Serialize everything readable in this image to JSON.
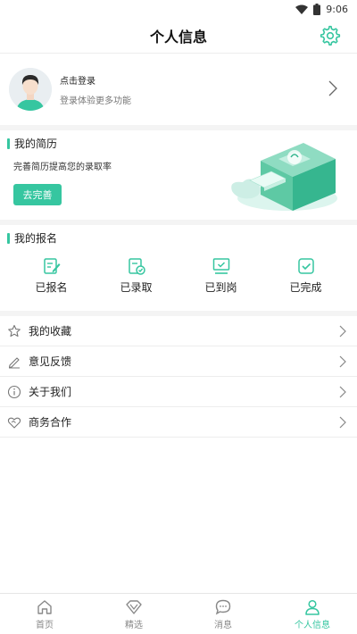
{
  "status_bar": {
    "time": "9:06"
  },
  "header": {
    "title": "个人信息"
  },
  "profile": {
    "title": "点击登录",
    "subtitle": "登录体验更多功能"
  },
  "resume": {
    "title": "我的简历",
    "description": "完善简历提高您的录取率",
    "button": "去完善"
  },
  "signup": {
    "title": "我的报名",
    "items": [
      {
        "label": "已报名",
        "icon": "edit-doc-icon"
      },
      {
        "label": "已录取",
        "icon": "approved-doc-icon"
      },
      {
        "label": "已到岗",
        "icon": "monitor-check-icon"
      },
      {
        "label": "已完成",
        "icon": "check-square-icon"
      }
    ]
  },
  "menu": [
    {
      "label": "我的收藏",
      "icon": "star-icon"
    },
    {
      "label": "意见反馈",
      "icon": "pencil-icon"
    },
    {
      "label": "关于我们",
      "icon": "info-icon"
    },
    {
      "label": "商务合作",
      "icon": "handshake-icon"
    }
  ],
  "tabs": [
    {
      "label": "首页",
      "icon": "home-icon"
    },
    {
      "label": "精选",
      "icon": "diamond-icon"
    },
    {
      "label": "消息",
      "icon": "chat-icon"
    },
    {
      "label": "个人信息",
      "icon": "person-icon",
      "active": true
    }
  ],
  "colors": {
    "accent": "#36c6a0",
    "divider": "#ededed"
  }
}
